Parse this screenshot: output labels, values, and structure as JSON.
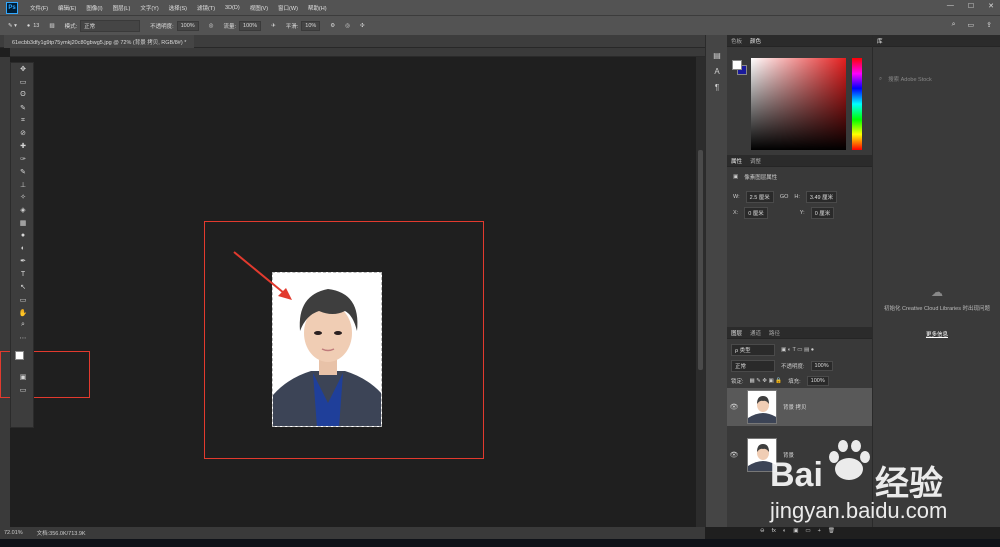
{
  "menubar": {
    "logo": "Ps",
    "items": [
      "文件(F)",
      "编辑(E)",
      "图像(I)",
      "图层(L)",
      "文字(Y)",
      "选择(S)",
      "滤镜(T)",
      "3D(D)",
      "视图(V)",
      "窗口(W)",
      "帮助(H)"
    ],
    "win_controls": [
      "—",
      "☐",
      "✕"
    ]
  },
  "options": {
    "size": "13",
    "mode_label": "模式:",
    "mode_value": "正常",
    "opacity_label": "不透明度:",
    "opacity_value": "100%",
    "flow_label": "流量:",
    "flow_value": "100%",
    "smooth_label": "平滑:",
    "smooth_value": "10%"
  },
  "document": {
    "tab_title": "61ecbb3dfy1g9tp75ymkj20c80gbwg5.jpg @ 72% (背景 拷贝, RGB/8#) *",
    "zoom": "72.01%",
    "doc_info": "文档:356.0K/713.9K"
  },
  "tools": [
    "✥",
    "▭",
    "ʘ",
    "✎",
    "⌗",
    "⊘",
    "✚",
    "✑",
    "✎",
    "⊥",
    "✧",
    "◈",
    "▦",
    "●",
    "◐",
    "✒",
    "T",
    "↖",
    "▭",
    "✋",
    "⌕",
    "⋯"
  ],
  "color_panel": {
    "tabs": [
      "色板",
      "颜色"
    ],
    "fg_color": "#ffffff",
    "bg_color": "#1a1a9a"
  },
  "properties_panel": {
    "tabs": [
      "属性",
      "调整"
    ],
    "type_label": "像素图层属性",
    "w_label": "W:",
    "w_value": "2.5 厘米",
    "link": "GO",
    "h_label": "H:",
    "h_value": "3.49 厘米",
    "x_label": "X:",
    "x_value": "0 厘米",
    "y_label": "Y:",
    "y_value": "0 厘米"
  },
  "layers_panel": {
    "tabs": [
      "图层",
      "通道",
      "路径"
    ],
    "filter_label": "ρ 类型",
    "blend_mode": "正常",
    "opacity_label": "不透明度:",
    "opacity_value": "100%",
    "lock_label": "锁定:",
    "fill_label": "填充:",
    "fill_value": "100%",
    "layers": [
      {
        "name": "背景 拷贝",
        "selected": true
      },
      {
        "name": "背景",
        "selected": false
      }
    ],
    "bottom_icons": [
      "⊖",
      "fx",
      "◐",
      "▣",
      "▭",
      "+",
      "🗑"
    ]
  },
  "libraries": {
    "tab": "库",
    "search_placeholder": "搜索 Adobe Stock",
    "message": "初始化 Creative Cloud Libraries 时出现问题",
    "link": "更多信息"
  },
  "watermark": {
    "brand_left": "Bai",
    "brand_right": "经验",
    "url": "jingyan.baidu.com"
  },
  "colors": {
    "annotation_red": "#e23a2e",
    "selected_layer": "#595959"
  }
}
